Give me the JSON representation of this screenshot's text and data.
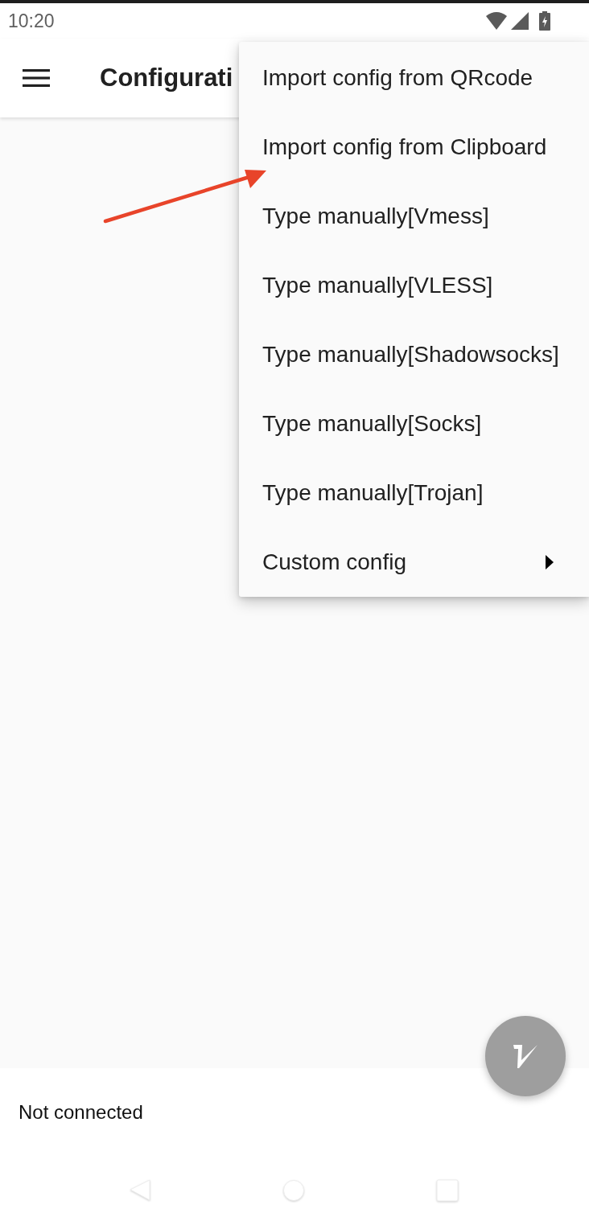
{
  "status_bar": {
    "time": "10:20"
  },
  "app_bar": {
    "title": "Configurati"
  },
  "menu": {
    "items": [
      {
        "label": "Import config from QRcode",
        "kind": "action"
      },
      {
        "label": "Import config from Clipboard",
        "kind": "action"
      },
      {
        "label": "Type manually[Vmess]",
        "kind": "action"
      },
      {
        "label": "Type manually[VLESS]",
        "kind": "action"
      },
      {
        "label": "Type manually[Shadowsocks]",
        "kind": "action"
      },
      {
        "label": "Type manually[Socks]",
        "kind": "action"
      },
      {
        "label": "Type manually[Trojan]",
        "kind": "action"
      },
      {
        "label": "Custom config",
        "kind": "submenu"
      }
    ]
  },
  "connection": {
    "status": "Not connected"
  }
}
